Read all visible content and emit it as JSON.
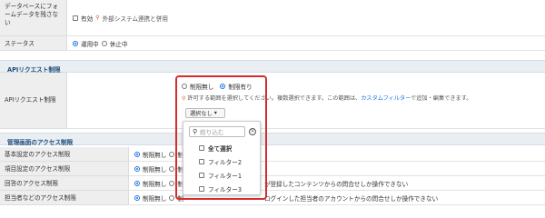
{
  "rows_top": [
    {
      "label": "データベースにフォームデータを残さない",
      "check_label": "有効",
      "note": "外部システム連携と併用"
    },
    {
      "label": "ステータス",
      "radio_on": "運用中",
      "radio_off": "休止中"
    }
  ],
  "api_section": {
    "title": "APIリクエスト制限",
    "label": "APIリクエスト制限",
    "radio_off": "制限無し",
    "radio_on": "制限有り",
    "note_prefix": "許可する範囲を選択してください。複数選択できます。この範囲は、",
    "note_link": "カスタムフィルター",
    "note_suffix": "で追加・編集できます。",
    "select_label": "選択なし"
  },
  "access_section": {
    "title": "管理画面のアクセス制限",
    "rows": [
      {
        "label": "基本設定のアクセス制限",
        "radio_on": "制限無し",
        "radio_off": "制",
        "extra": ""
      },
      {
        "label": "項目設定のアクセス制限",
        "radio_on": "制限無し",
        "radio_off": "制",
        "extra": ""
      },
      {
        "label": "回答のアクセス制限",
        "radio_on": "制限無し",
        "radio_off": "制",
        "extra": "が登録したコンテンツからの問合せしか操作できない"
      },
      {
        "label": "担当者などのアクセス制限",
        "radio_on": "制限無し",
        "radio_off": "制",
        "extra": "ログインした担当者のアカウントからの問合せしか操作できない"
      }
    ]
  },
  "dropdown": {
    "search_placeholder": "絞り込む",
    "options": [
      "全て選択",
      "フィルター2",
      "フィルター1",
      "フィルター3"
    ]
  },
  "colors": {
    "highlight": "#d62d2d",
    "link": "#1a73e8",
    "section_bg": "#e9eef3"
  }
}
